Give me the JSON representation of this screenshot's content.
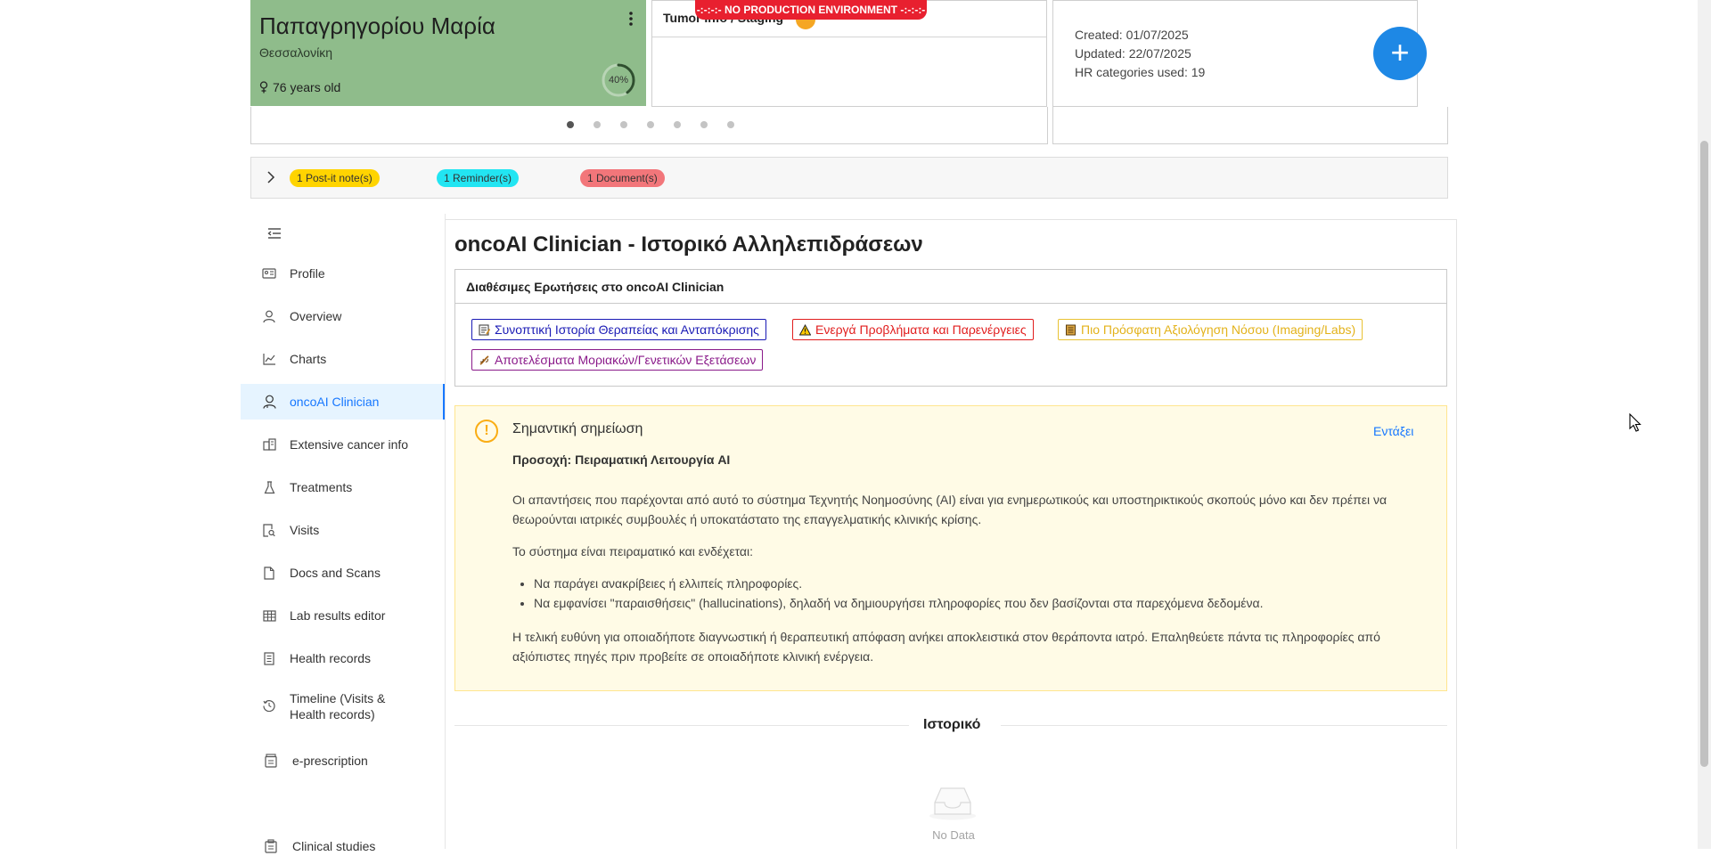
{
  "patient": {
    "name": "Παπαγρηγορίου Μαρία",
    "city": "Θεσσαλονίκη",
    "age": "76 years old",
    "completion": "40%",
    "completion_fraction": 0.4
  },
  "tumor_card": {
    "title": "Tumor Info / Staging"
  },
  "env_banner": "-:-:-:- NO PRODUCTION ENVIRONMENT -:-:-:-",
  "record_info": {
    "created": "Created: 01/07/2025",
    "updated": "Updated: 22/07/2025",
    "hr_categories": "HR categories used: 19",
    "add_label": "+"
  },
  "notes_bar": {
    "postit": "1 Post-it note(s)",
    "reminder": "1 Reminder(s)",
    "document": "1 Document(s)"
  },
  "sidebar": {
    "items": [
      {
        "label": "Profile",
        "icon": "id-card-icon"
      },
      {
        "label": "Overview",
        "icon": "user-icon"
      },
      {
        "label": "Charts",
        "icon": "line-chart-icon"
      },
      {
        "label": "oncoAI Clinician",
        "icon": "doctor-icon",
        "active": true
      },
      {
        "label": "Extensive cancer info",
        "icon": "building-icon"
      },
      {
        "label": "Treatments",
        "icon": "flask-icon"
      },
      {
        "label": "Visits",
        "icon": "file-search-icon"
      },
      {
        "label": "Docs and Scans",
        "icon": "file-icon"
      },
      {
        "label": "Lab results editor",
        "icon": "table-icon"
      },
      {
        "label": "Health records",
        "icon": "book-icon"
      },
      {
        "label": "Timeline (Visits & Health records)",
        "icon": "history-icon"
      },
      {
        "label": "e-prescription",
        "icon": "prescription-icon"
      },
      {
        "label": "Clinical studies",
        "icon": "study-icon"
      }
    ]
  },
  "main": {
    "title": "oncoAI Clinician - Ιστορικό Αλληλεπιδράσεων",
    "questions": {
      "title": "Διαθέσιμες Ερωτήσεις στο oncoAI Clinician",
      "items": [
        "Συνοπτική Ιστορία Θεραπείας και Ανταπόκρισης",
        "Ενεργά Προβλήματα και Παρενέργειες",
        "Πιο Πρόσφατη Αξιολόγηση Νόσου (Imaging/Labs)",
        "Αποτελέσματα Μοριακών/Γενετικών Εξετάσεων"
      ]
    },
    "notice": {
      "title": "Σημαντική σημείωση",
      "close": "Εντάξει",
      "subtitle": "Προσοχή: Πειραματική Λειτουργία AI",
      "p1": "Οι απαντήσεις που παρέχονται από αυτό το σύστημα Τεχνητής Νοημοσύνης (AI) είναι για ενημερωτικούς και υποστηρικτικούς σκοπούς μόνο και δεν πρέπει να θεωρούνται ιατρικές συμβουλές ή υποκατάστατο της επαγγελματικής κλινικής κρίσης.",
      "p2": "Το σύστημα είναι πειραματικό και ενδέχεται:",
      "bullets": [
        "Να παράγει ανακρίβειες ή ελλιπείς πληροφορίες.",
        "Να εμφανίσει \"παραισθήσεις\" (hallucinations), δηλαδή να δημιουργήσει πληροφορίες που δεν βασίζονται στα παρεχόμενα δεδομένα."
      ],
      "p3": "Η τελική ευθύνη για οποιαδήποτε διαγνωστική ή θεραπευτική απόφαση ανήκει αποκλειστικά στον θεράποντα ιατρό. Επαληθεύετε πάντα τις πληροφορίες από αξιόπιστες πηγές πριν προβείτε σε οποιαδήποτε κλινική ενέργεια."
    },
    "history_label": "Ιστορικό",
    "empty_text": "No Data"
  }
}
